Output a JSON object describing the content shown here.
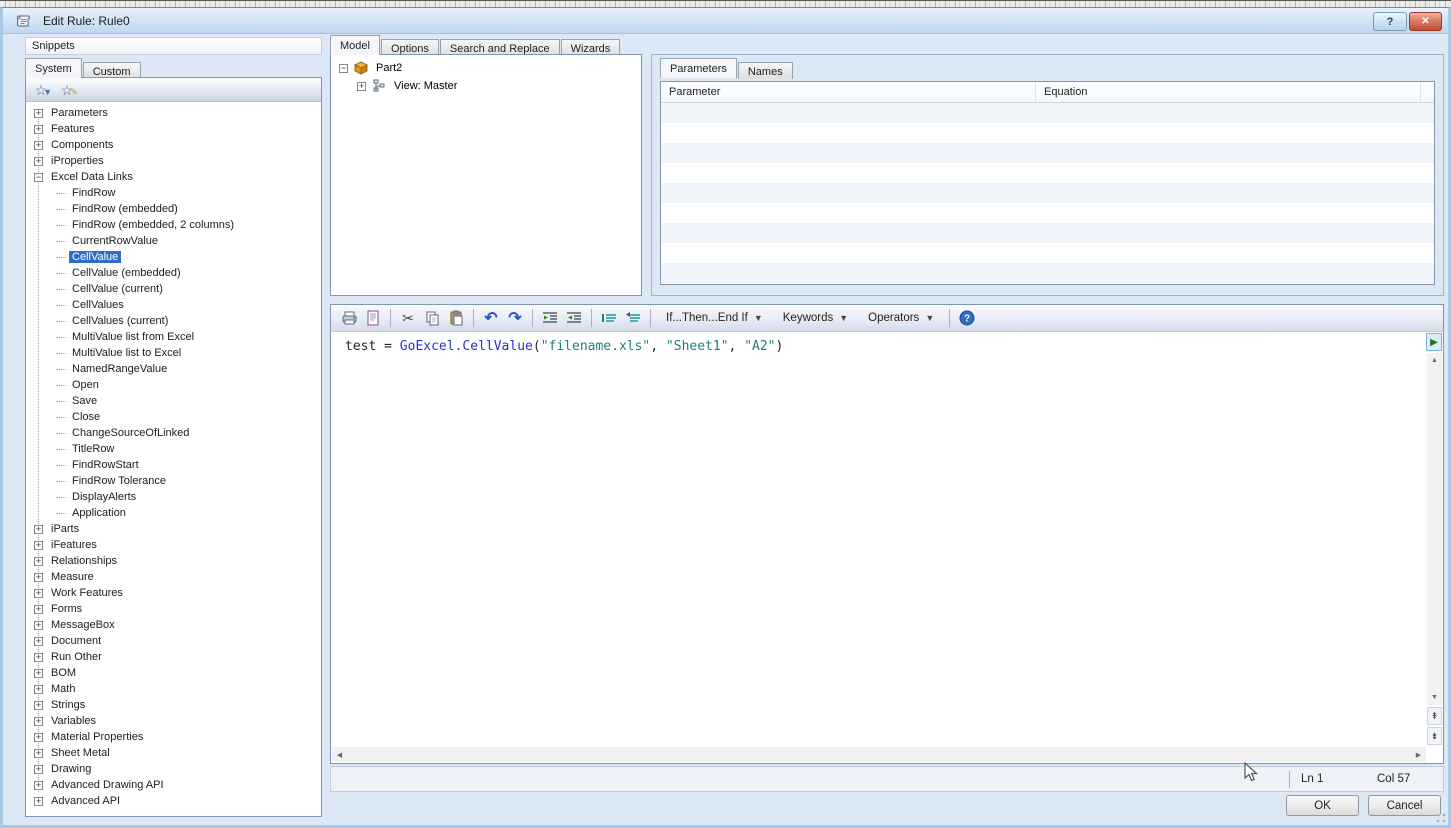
{
  "window": {
    "title": "Edit Rule: Rule0",
    "help_label": "?",
    "close_label": "✕"
  },
  "snippets": {
    "header": "Snippets",
    "tabs": [
      {
        "label": "System",
        "active": true
      },
      {
        "label": "Custom",
        "active": false
      }
    ],
    "toolbar_icons": [
      "filter-snippets-star-icon",
      "edit-snippets-star-icon"
    ],
    "selected_item": "CellValue",
    "tree": [
      {
        "label": "Parameters",
        "expand": "+"
      },
      {
        "label": "Features",
        "expand": "+"
      },
      {
        "label": "Components",
        "expand": "+"
      },
      {
        "label": "iProperties",
        "expand": "+"
      },
      {
        "label": "Excel Data Links",
        "expand": "-",
        "children": [
          "FindRow",
          "FindRow (embedded)",
          "FindRow (embedded, 2 columns)",
          "CurrentRowValue",
          "CellValue",
          "CellValue (embedded)",
          "CellValue (current)",
          "CellValues",
          "CellValues (current)",
          "MultiValue list from Excel",
          "MultiValue list to Excel",
          "NamedRangeValue",
          "Open",
          "Save",
          "Close",
          "ChangeSourceOfLinked",
          "TitleRow",
          "FindRowStart",
          "FindRow Tolerance",
          "DisplayAlerts",
          "Application"
        ]
      },
      {
        "label": "iParts",
        "expand": "+"
      },
      {
        "label": "iFeatures",
        "expand": "+"
      },
      {
        "label": "Relationships",
        "expand": "+"
      },
      {
        "label": "Measure",
        "expand": "+"
      },
      {
        "label": "Work Features",
        "expand": "+"
      },
      {
        "label": "Forms",
        "expand": "+"
      },
      {
        "label": "MessageBox",
        "expand": "+"
      },
      {
        "label": "Document",
        "expand": "+"
      },
      {
        "label": "Run Other",
        "expand": "+"
      },
      {
        "label": "BOM",
        "expand": "+"
      },
      {
        "label": "Math",
        "expand": "+"
      },
      {
        "label": "Strings",
        "expand": "+"
      },
      {
        "label": "Variables",
        "expand": "+"
      },
      {
        "label": "Material Properties",
        "expand": "+"
      },
      {
        "label": "Sheet Metal",
        "expand": "+"
      },
      {
        "label": "Drawing",
        "expand": "+"
      },
      {
        "label": "Advanced Drawing API",
        "expand": "+"
      },
      {
        "label": "Advanced API",
        "expand": "+"
      }
    ]
  },
  "model_panel": {
    "tabs": [
      {
        "label": "Model",
        "active": true
      },
      {
        "label": "Options",
        "active": false
      },
      {
        "label": "Search and Replace",
        "active": false
      },
      {
        "label": "Wizards",
        "active": false
      }
    ],
    "tree": [
      {
        "label": "Part2",
        "expand": "-",
        "icon": "part-cube-icon"
      },
      {
        "label": "View: Master",
        "expand": "+",
        "icon": "view-icon"
      }
    ]
  },
  "parameters_panel": {
    "tabs": [
      {
        "label": "Parameters",
        "active": true
      },
      {
        "label": "Names",
        "active": false
      }
    ],
    "columns": [
      "Parameter",
      "Equation"
    ],
    "rows": [],
    "empty_row_count": 9
  },
  "editor": {
    "toolbar_icons": [
      "print-icon",
      "print-preview-icon",
      "cut-icon",
      "copy-icon",
      "paste-icon",
      "undo-icon",
      "redo-icon",
      "indent-icon",
      "outdent-icon",
      "comment-icon",
      "uncomment-icon",
      "help-icon"
    ],
    "dropdowns": [
      "If...Then...End If",
      "Keywords",
      "Operators"
    ],
    "code_line": [
      {
        "text": "test = ",
        "color": "#262626"
      },
      {
        "text": "GoExcel.CellValue",
        "color": "#2633cc"
      },
      {
        "text": "(",
        "color": "#262626"
      },
      {
        "text": "\"filename.xls\"",
        "color": "#1d8181"
      },
      {
        "text": ", ",
        "color": "#262626"
      },
      {
        "text": "\"Sheet1\"",
        "color": "#1d8181"
      },
      {
        "text": ", ",
        "color": "#262626"
      },
      {
        "text": "\"A2\"",
        "color": "#1d8181"
      },
      {
        "text": ")",
        "color": "#262626"
      }
    ],
    "status": {
      "line": "Ln 1",
      "column": "Col 57"
    }
  },
  "actions": {
    "ok": "OK",
    "cancel": "Cancel"
  },
  "colors": {
    "selection": "#2f6cc4",
    "string": "#1d8181",
    "function": "#2633cc",
    "titlebar": "#d4e5f7",
    "dialog_bg": "#dce8f6",
    "close_button": "#c14d35"
  }
}
